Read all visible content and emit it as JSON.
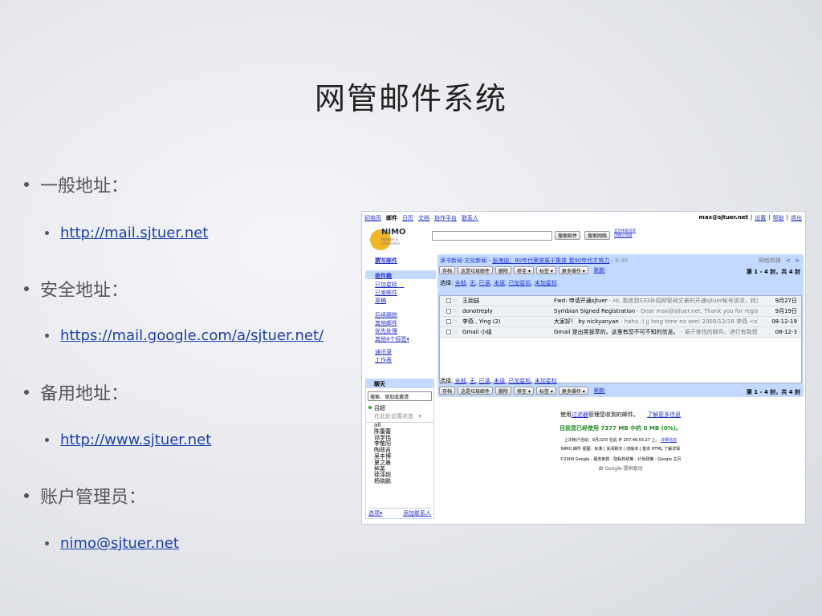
{
  "slide": {
    "title": "网管邮件系统",
    "bullets": [
      {
        "label": "一般地址：",
        "link": "http://mail.sjtuer.net"
      },
      {
        "label": "安全地址：",
        "link": "https://mail.google.com/a/sjtuer.net/"
      },
      {
        "label": "备用地址：",
        "link": "http://www.sjtuer.net"
      },
      {
        "label": "账户管理员：",
        "link": "nimo@sjtuer.net"
      }
    ]
  },
  "gmail": {
    "topnav": [
      "初始页",
      "邮件",
      "日历",
      "文档",
      "协作平台",
      "联系人"
    ],
    "user": {
      "email": "max@sjtuer.net",
      "settings": "设置",
      "help": "帮助",
      "logout": "退出"
    },
    "logo": {
      "name": "NIMO",
      "sub": "Network & Information"
    },
    "search": {
      "mail_button": "搜索邮件",
      "web_button": "搜索网络",
      "show_options": "显示搜索选项",
      "create_filter": "创建过滤器"
    },
    "left_nav": {
      "compose": "撰写邮件",
      "inbox": "收件箱",
      "starred": "已加星标",
      "sent": "已发邮件",
      "drafts": "草稿",
      "followup": "后续跟踪",
      "other_mail": "其他邮件",
      "priority": "优先处理",
      "more_labels": "其他4个标签▾",
      "contacts": "通讯录",
      "tasks": "工作表"
    },
    "chat": {
      "header": "聊天",
      "search_placeholder": "搜索、添加或邀请",
      "me": "吕超",
      "status": "在此处设置状态",
      "contacts": [
        "all",
        "陈蕾蕾",
        "邓学伟",
        "李敬阳",
        "陶政吉",
        "吴丰博",
        "夏之晨",
        "熊英",
        "徐泽超",
        "杨晓鹏"
      ],
      "options": "选项▾",
      "add_contact": "添加联系人"
    },
    "news": {
      "source": "读书新闻·文化新闻",
      "headline": "张海迪：80年代荣誉属于集体 我90年代才努力",
      "time": "- 9:30",
      "older": "网络剪辑"
    },
    "toolbar": {
      "archive": "存档",
      "spam": "这是垃圾邮件",
      "delete": "删除",
      "move_to": "移至 ▾",
      "labels": "标签 ▾",
      "more_actions": "更多操作 ▾",
      "refresh": "刷新",
      "count": "第 1 - 4 封，共 4 封"
    },
    "select": {
      "label": "选择:",
      "options": [
        "全部",
        "无",
        "已读",
        "未读",
        "已加星标",
        "未加星标"
      ]
    },
    "emails": [
      {
        "from": "王勐喆",
        "subject": "Fwd: 申请开通sjtuer",
        "snippet": " - Hi, 我收到S33补招网管闻文豪的开通sjtuer帐号请求，转发给",
        "date": "9月27日"
      },
      {
        "from": "donotreply",
        "subject": "Symbian Signed Registration",
        "snippet": " - Dear max@sjtuer.net, Thank you for registering with",
        "date": "9月19日"
      },
      {
        "from": "李燕 , Ying (2)",
        "subject": "大家好！ by nickyanyan",
        "snippet": " - haha :) jj long time no see! 2008/12/18 李燕 <xhnet@sjt",
        "date": "08-12-19"
      },
      {
        "from": "Gmail 小组",
        "subject": "Gmail 是出类拔萃的。这里有您不可不知的信息。",
        "snippet": " - 易于查找的邮件，进行有我想到",
        "date": "08-12-3"
      }
    ],
    "footer": {
      "filter_pre": "使用",
      "filter_link": "过滤器",
      "filter_post": "管理您收到的邮件。",
      "learn_more": "了解更多信息",
      "usage": "目前您已经使用 7377 MB 中的 0 MB (0%)。",
      "last_activity": "上次帐户活动：9月22日 在此 IP 207.46.55.27 上。",
      "details": "详细信息",
      "view_line": "NIMO 邮件 视图：标准 | 关闭聊天 | 旧版本 | 基本 HTML  了解详情",
      "copyright": "©2009 Google - 服务条款 - 隐私权政策 - 计划政策 - Google 主页",
      "powered": "由 Google 提供驱动"
    }
  }
}
